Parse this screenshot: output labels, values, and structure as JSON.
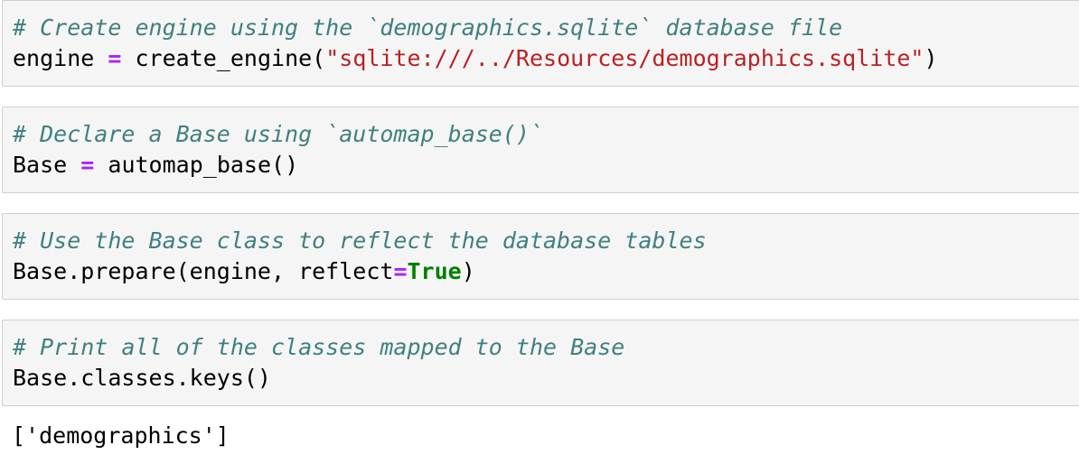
{
  "cells": [
    {
      "comment": "# Create engine using the `demographics.sqlite` database file",
      "code": {
        "var": "engine",
        "op": "=",
        "func_open": "create_engine(",
        "string": "\"sqlite:///../Resources/demographics.sqlite\"",
        "close": ")"
      }
    },
    {
      "comment": "# Declare a Base using `automap_base()`",
      "code": {
        "var": "Base",
        "op": "=",
        "call": "automap_base()"
      }
    },
    {
      "comment": "# Use the Base class to reflect the database tables",
      "code": {
        "call_open": "Base.prepare(engine, reflect",
        "op": "=",
        "keyword": "True",
        "close": ")"
      }
    },
    {
      "comment": "# Print all of the classes mapped to the Base",
      "code": {
        "call": "Base.classes.keys()"
      }
    }
  ],
  "output": "['demographics']",
  "colors": {
    "comment": "#408080",
    "operator": "#aa22ff",
    "string": "#ba2121",
    "keyword": "#008000",
    "cell_background": "#f5f5f5",
    "cell_border": "#cfcfcf"
  }
}
